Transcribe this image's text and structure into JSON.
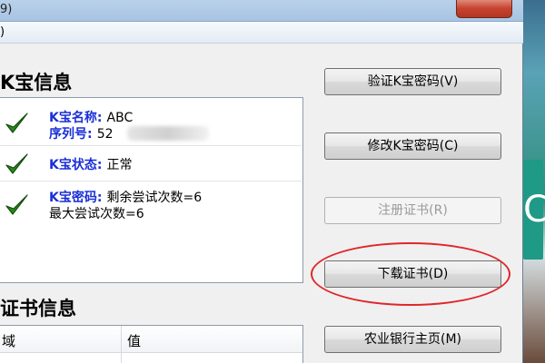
{
  "window": {
    "title": "9)",
    "menu_text": ")"
  },
  "kbao": {
    "section_title": "K宝信息",
    "name_label": "K宝名称:",
    "name_value": "ABC",
    "serial_label": "序列号:",
    "serial_value": "52",
    "status_label": "K宝状态:",
    "status_value": "正常",
    "password_label": "K宝密码:",
    "password_value": "剩余尝试次数=6",
    "password_max": "最大尝试次数=6"
  },
  "buttons": {
    "verify": "验证K宝密码(V)",
    "modify": "修改K宝密码(C)",
    "register": "注册证书(R)",
    "download": "下载证书(D)",
    "homepage": "农业银行主页(M)"
  },
  "cert": {
    "section_title": "证书信息",
    "columns": [
      "域",
      "值"
    ]
  },
  "colors": {
    "label_blue": "#1a2fd6",
    "check_green": "#2a8a1d",
    "annotation_red": "#e0262a"
  }
}
